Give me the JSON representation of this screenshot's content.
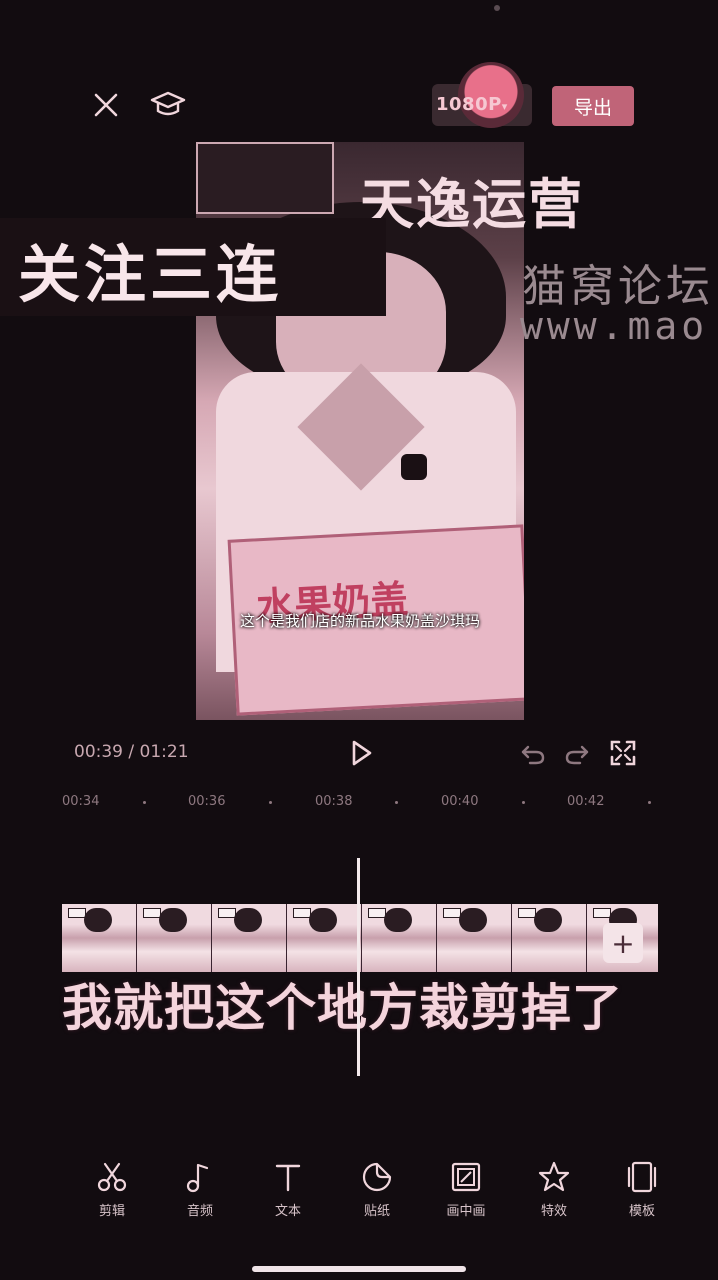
{
  "topbar": {
    "resolution_label": "1080P",
    "export_label": "导出"
  },
  "video": {
    "subtitle": "这个是我们店的新品水果奶盖沙琪玛",
    "box_text": "水果奶盖"
  },
  "overlays": {
    "title_right": "天逸运营",
    "title_left": "关注三连",
    "watermark_line1": "猫窝论坛",
    "watermark_line2": "www.mao"
  },
  "playback": {
    "current_time": "00:39",
    "separator": " / ",
    "total_time": "01:21"
  },
  "ruler": {
    "ticks": [
      "00:34",
      "00:36",
      "00:38",
      "00:40",
      "00:42"
    ]
  },
  "timeline": {
    "caption": "我就把这个地方裁剪掉了",
    "add_label": "+"
  },
  "toolbar": {
    "items": [
      {
        "label": "剪辑",
        "icon": "scissors-icon"
      },
      {
        "label": "音频",
        "icon": "music-note-icon"
      },
      {
        "label": "文本",
        "icon": "text-icon"
      },
      {
        "label": "贴纸",
        "icon": "sticker-icon"
      },
      {
        "label": "画中画",
        "icon": "picture-in-picture-icon"
      },
      {
        "label": "特效",
        "icon": "effects-star-icon"
      },
      {
        "label": "模板",
        "icon": "template-icon"
      }
    ]
  },
  "colors": {
    "background": "#120c10",
    "accent": "#c06478",
    "text": "#f0d6dc"
  }
}
